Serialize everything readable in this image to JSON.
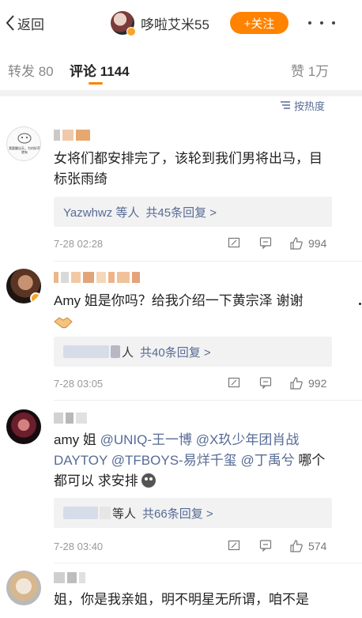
{
  "header": {
    "back_label": "返回",
    "user_name": "哆啦艾米55",
    "follow_label": "+关注"
  },
  "tabs": {
    "repost": "转发 80",
    "comments": "评论 1144",
    "likes": "赞 1万"
  },
  "sort_label": "按热度",
  "comments": [
    {
      "text": "女将们都安排完了，该轮到我们男将出马，目标张雨绮",
      "avatar_caption": "我要翻出天，为何好奇就有",
      "reply": {
        "who": "Yazwhwz 等人",
        "count": "共45条回复 >"
      },
      "time": "7-28 02:28",
      "likes": "994"
    },
    {
      "text": "Amy 姐是你吗？给我介绍一下黄宗泽 谢谢",
      "emoji": "handshake",
      "reply": {
        "who": "人",
        "count": "共40条回复 >"
      },
      "time": "7-28 03:05",
      "likes": "992"
    },
    {
      "text_parts": [
        "amy 姐 ",
        "@UNIQ-王一博",
        " ",
        "@X玖少年团肖战 DAYTOY",
        " ",
        "@TFBOYS-易烊千玺",
        " ",
        "@丁禹兮",
        " 哪个都可以 求安排"
      ],
      "reply": {
        "who": "等人",
        "count": "共66条回复 >"
      },
      "time": "7-28 03:40",
      "likes": "574"
    },
    {
      "text": "姐，你是我亲姐，明不明星无所谓，咱不是"
    }
  ],
  "icons": [
    "chevron-left-icon",
    "more-dots-icon",
    "sort-icon",
    "repost-icon",
    "comment-icon",
    "thumb-up-icon",
    "verified-badge-icon"
  ],
  "colors": {
    "accent": "#ff8200",
    "link": "#576b95",
    "verified": "#f7a528"
  }
}
